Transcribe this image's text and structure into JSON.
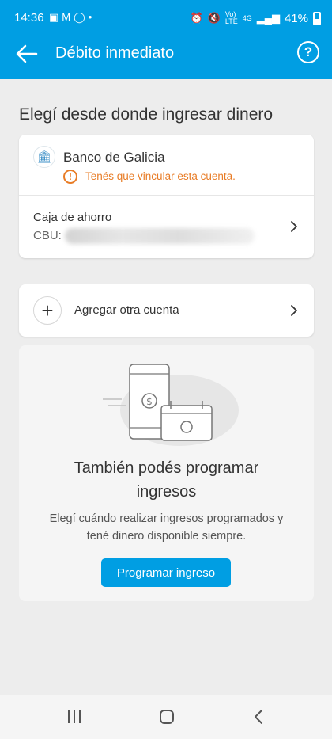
{
  "status": {
    "time": "14:36",
    "battery": "41%",
    "left_icons": [
      "image-icon",
      "gmail-icon",
      "whatsapp-icon",
      "dot-icon"
    ],
    "right_icons": [
      "alarm-icon",
      "mute-icon",
      "volte-icon",
      "4g-icon",
      "signal-icon",
      "battery-icon"
    ]
  },
  "appbar": {
    "title": "Débito inmediato",
    "help_label": "?"
  },
  "main": {
    "section_title": "Elegí desde donde ingresar dinero",
    "bank": {
      "name": "Banco de Galicia",
      "warning": "Tenés que vincular esta cuenta.",
      "account_type": "Caja de ahorro",
      "cbu_label": "CBU:"
    },
    "add_account": {
      "label": "Agregar otra cuenta"
    },
    "promo": {
      "title_line1": "También podés programar",
      "title_line2": "ingresos",
      "desc_line1": "Elegí cuándo realizar ingresos programados y",
      "desc_line2": "tené dinero disponible siempre.",
      "button": "Programar ingreso"
    }
  },
  "colors": {
    "brand": "#009ee3",
    "warning": "#e87c26",
    "background": "#ededed"
  }
}
